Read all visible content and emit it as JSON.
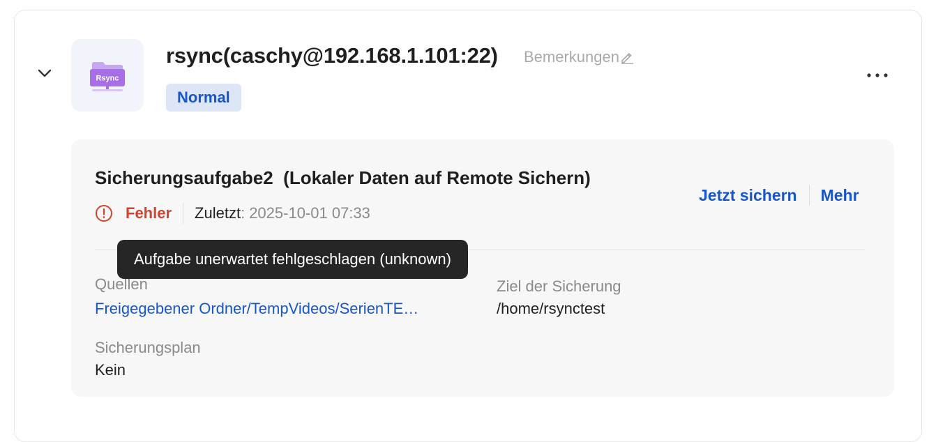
{
  "header": {
    "title": "rsync(caschy@192.168.1.101:22)",
    "remarks_label": "Bemerkungen",
    "status_badge": "Normal",
    "app_icon_text": "Rsync",
    "expand_icon": "chevron-down-icon",
    "more_icon": "more-horizontal-icon",
    "edit_icon": "pencil-icon"
  },
  "task": {
    "title": "Sicherungsaufgabe2  (Lokaler Daten auf Remote Sichern)",
    "status_text": "Fehler",
    "status_icon": "error-circle-icon",
    "last_label": "Zuletzt",
    "last_colon": ":",
    "last_value": "2025-10-01 07:33",
    "actions": {
      "backup_now": "Jetzt sichern",
      "more": "Mehr"
    },
    "tooltip": "Aufgabe unerwartet fehlgeschlagen (unknown)",
    "sources_label": "Quellen",
    "sources_value": "Freigegebener Ordner/TempVideos/SerienTE…",
    "target_label": "Ziel der Sicherung",
    "target_value": "/home/rsynctest",
    "schedule_label": "Sicherungsplan",
    "schedule_value": "Kein"
  },
  "colors": {
    "accent": "#1656c9",
    "error": "#d0432e",
    "badge_bg": "#dde6f7",
    "icon_purple": "#a86ee8",
    "tooltip_bg": "#262626"
  }
}
